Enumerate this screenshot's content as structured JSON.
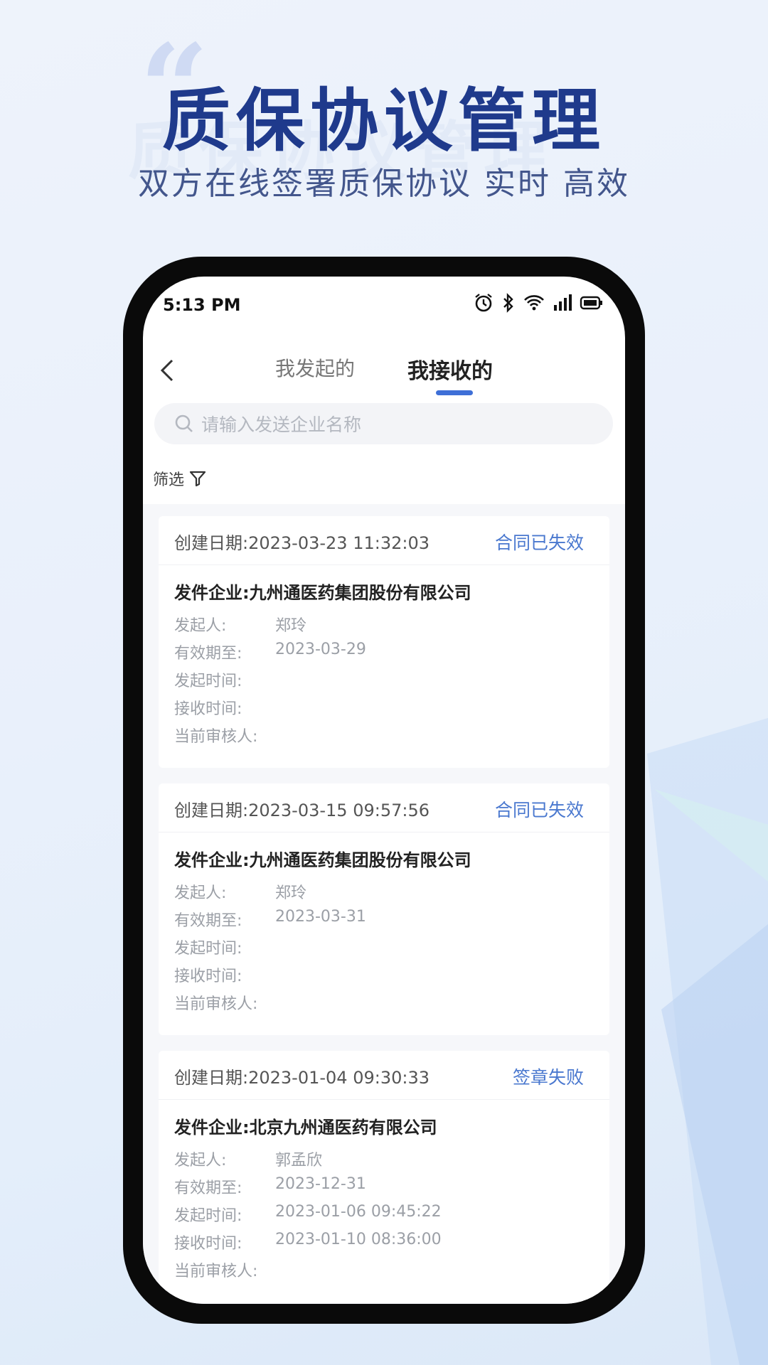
{
  "hero": {
    "quote": "“",
    "ghost_text": "质保协议管理",
    "title": "质保协议管理",
    "subtitle": "双方在线签署质保协议 实时 高效"
  },
  "status_bar": {
    "time": "5:13 PM",
    "icons": [
      "alarm-icon",
      "bluetooth-icon",
      "wifi-icon",
      "signal-icon",
      "battery-icon"
    ]
  },
  "nav": {
    "back_icon": "chevron-left-icon",
    "tabs": [
      {
        "label": "我发起的",
        "active": false
      },
      {
        "label": "我接收的",
        "active": true
      }
    ],
    "accent_color": "#3e6fd7"
  },
  "search": {
    "placeholder": "请输入发送企业名称"
  },
  "filter": {
    "label": "筛选",
    "icon": "filter-icon"
  },
  "cards": [
    {
      "created": "创建日期:2023-03-23 11:32:03",
      "status": "合同已失效",
      "company": "发件企业:九州通医药集团股份有限公司",
      "fields": [
        {
          "label": "发起人:",
          "value": "郑玲"
        },
        {
          "label": "有效期至:",
          "value": "2023-03-29"
        },
        {
          "label": "发起时间:",
          "value": ""
        },
        {
          "label": "接收时间:",
          "value": ""
        },
        {
          "label": "当前审核人:",
          "value": ""
        }
      ]
    },
    {
      "created": "创建日期:2023-03-15 09:57:56",
      "status": "合同已失效",
      "company": "发件企业:九州通医药集团股份有限公司",
      "fields": [
        {
          "label": "发起人:",
          "value": "郑玲"
        },
        {
          "label": "有效期至:",
          "value": "2023-03-31"
        },
        {
          "label": "发起时间:",
          "value": ""
        },
        {
          "label": "接收时间:",
          "value": ""
        },
        {
          "label": "当前审核人:",
          "value": ""
        }
      ]
    },
    {
      "created": "创建日期:2023-01-04 09:30:33",
      "status": "签章失败",
      "company": "发件企业:北京九州通医药有限公司",
      "fields": [
        {
          "label": "发起人:",
          "value": "郭孟欣"
        },
        {
          "label": "有效期至:",
          "value": "2023-12-31"
        },
        {
          "label": "发起时间:",
          "value": "2023-01-06 09:45:22"
        },
        {
          "label": "接收时间:",
          "value": "2023-01-10 08:36:00"
        },
        {
          "label": "当前审核人:",
          "value": ""
        }
      ]
    }
  ]
}
